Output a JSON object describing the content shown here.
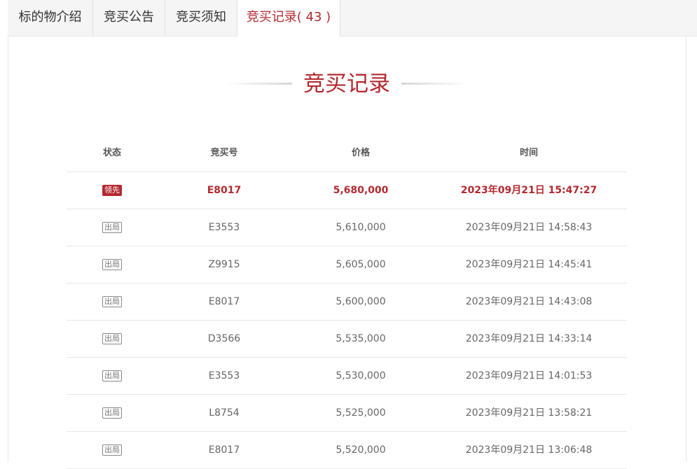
{
  "tabs": [
    {
      "label": "标的物介绍"
    },
    {
      "label": "竞买公告"
    },
    {
      "label": "竞买须知"
    },
    {
      "label": "竞买记录",
      "count": "( 43 )"
    }
  ],
  "section_title": "竞买记录",
  "table": {
    "headers": [
      "状态",
      "竞买号",
      "价格",
      "时间"
    ],
    "rows": [
      {
        "status": "领先",
        "bid_no": "E8017",
        "price": "5,680,000",
        "time": "2023年09月21日 15:47:27"
      },
      {
        "status": "出局",
        "bid_no": "E3553",
        "price": "5,610,000",
        "time": "2023年09月21日 14:58:43"
      },
      {
        "status": "出局",
        "bid_no": "Z9915",
        "price": "5,605,000",
        "time": "2023年09月21日 14:45:41"
      },
      {
        "status": "出局",
        "bid_no": "E8017",
        "price": "5,600,000",
        "time": "2023年09月21日 14:43:08"
      },
      {
        "status": "出局",
        "bid_no": "D3566",
        "price": "5,535,000",
        "time": "2023年09月21日 14:33:14"
      },
      {
        "status": "出局",
        "bid_no": "E3553",
        "price": "5,530,000",
        "time": "2023年09月21日 14:01:53"
      },
      {
        "status": "出局",
        "bid_no": "L8754",
        "price": "5,525,000",
        "time": "2023年09月21日 13:58:21"
      },
      {
        "status": "出局",
        "bid_no": "E8017",
        "price": "5,520,000",
        "time": "2023年09月21日 13:06:48"
      }
    ]
  },
  "colors": {
    "accent": "#b3292f",
    "text": "#666666",
    "divider": "#e6e6e6"
  }
}
